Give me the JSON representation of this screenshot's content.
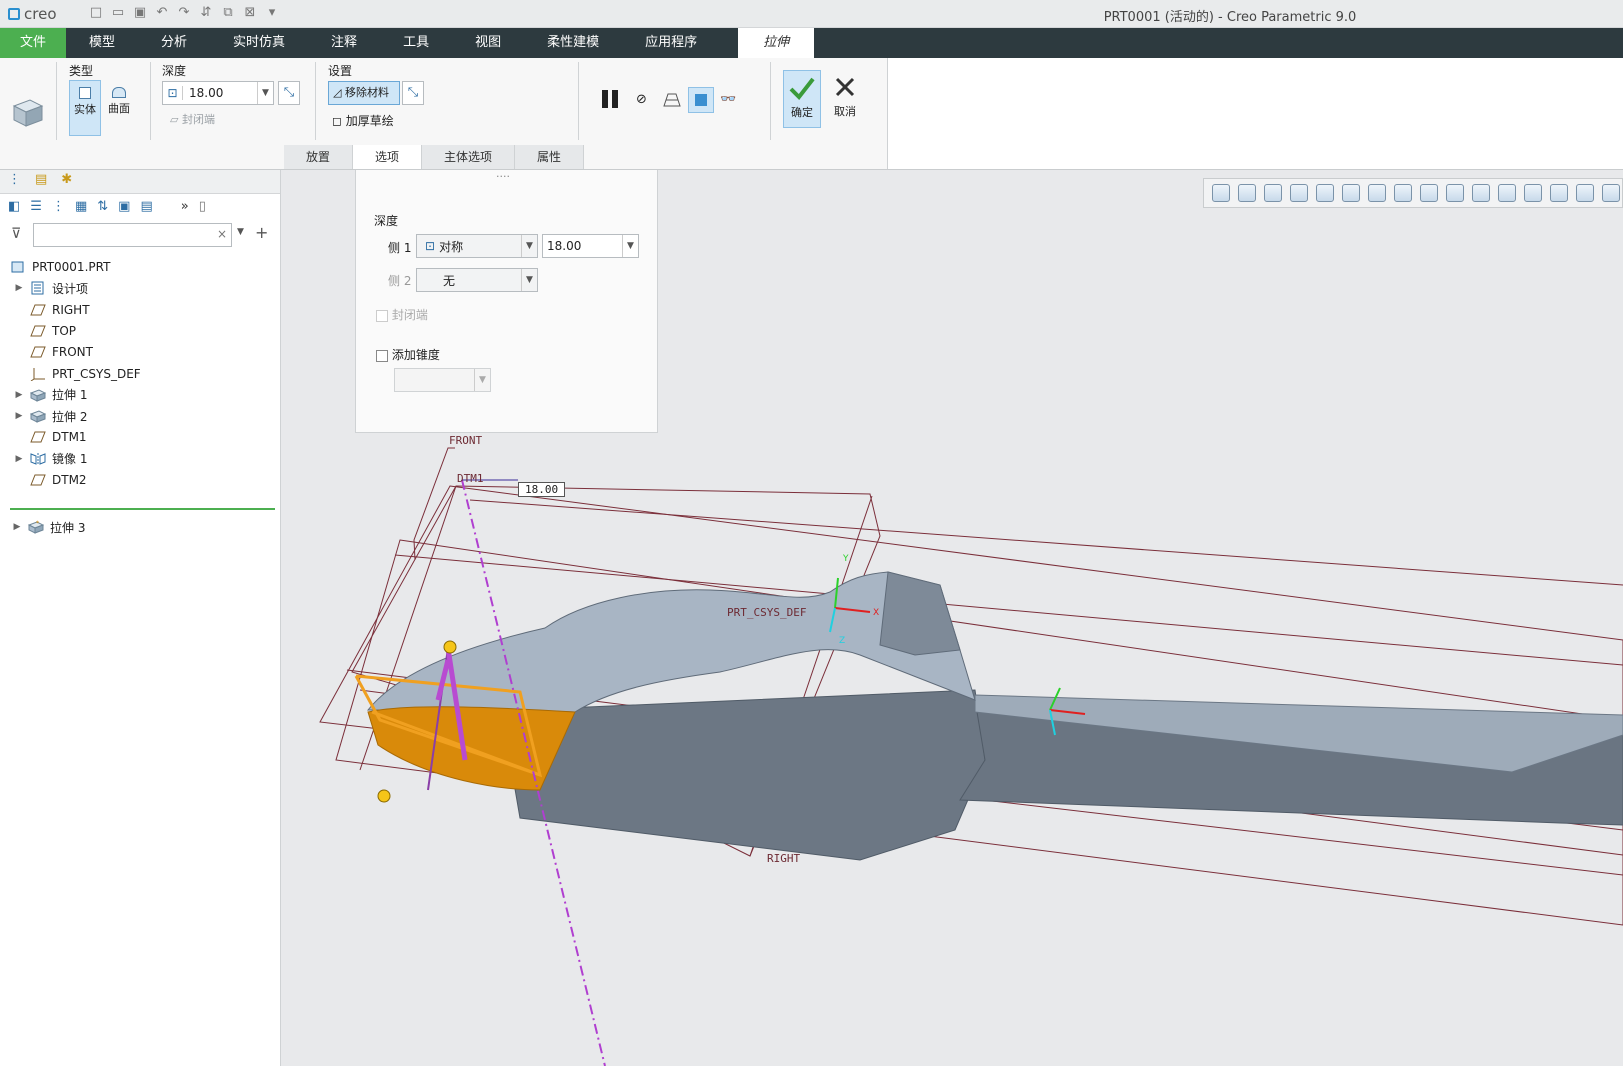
{
  "app": {
    "logo_text": "creo",
    "window_title": "PRT0001 (活动的) - Creo Parametric 9.0"
  },
  "tabs": {
    "file": "文件",
    "items": [
      "模型",
      "分析",
      "实时仿真",
      "注释",
      "工具",
      "视图",
      "柔性建模",
      "应用程序"
    ],
    "active": "拉伸"
  },
  "ribbon": {
    "type_label": "类型",
    "solid_label": "实体",
    "surface_label": "曲面",
    "depth_label": "深度",
    "depth_value": "18.00",
    "capped_label": "封闭端",
    "settings_label": "设置",
    "remove_material_label": "移除材料",
    "thicken_label": "加厚草绘",
    "ok_label": "确定",
    "cancel_label": "取消",
    "subtabs": [
      "放置",
      "选项",
      "主体选项",
      "属性"
    ],
    "active_subtab": "选项"
  },
  "options_panel": {
    "grip": "····",
    "depth_label": "深度",
    "side1_label": "侧 1",
    "side1_type": "对称",
    "side1_value": "18.00",
    "side2_label": "侧 2",
    "side2_type": "无",
    "capped_label": "封闭端",
    "taper_label": "添加锥度",
    "taper_value": ""
  },
  "model_tree": {
    "search_placeholder": "",
    "items": [
      {
        "label": "PRT0001.PRT",
        "icon": "part-icon",
        "expandable": false,
        "level": 0
      },
      {
        "label": "设计项",
        "icon": "design-items-icon",
        "expandable": true,
        "level": 1
      },
      {
        "label": "RIGHT",
        "icon": "datum-plane-icon",
        "expandable": false,
        "level": 1
      },
      {
        "label": "TOP",
        "icon": "datum-plane-icon",
        "expandable": false,
        "level": 1
      },
      {
        "label": "FRONT",
        "icon": "datum-plane-icon",
        "expandable": false,
        "level": 1
      },
      {
        "label": "PRT_CSYS_DEF",
        "icon": "csys-icon",
        "expandable": false,
        "level": 1
      },
      {
        "label": "拉伸 1",
        "icon": "extrude-icon",
        "expandable": true,
        "level": 1
      },
      {
        "label": "拉伸 2",
        "icon": "extrude-icon",
        "expandable": true,
        "level": 1
      },
      {
        "label": "DTM1",
        "icon": "datum-plane-icon",
        "expandable": false,
        "level": 1
      },
      {
        "label": "镜像 1",
        "icon": "mirror-icon",
        "expandable": true,
        "level": 1
      },
      {
        "label": "DTM2",
        "icon": "datum-plane-icon",
        "expandable": false,
        "level": 1
      }
    ],
    "insert_item": {
      "label": "拉伸 3",
      "icon": "extrude-new-icon",
      "expandable": true
    }
  },
  "viewport": {
    "label_front": "FRONT",
    "label_dtm1": "DTM1",
    "dim_value": "18.00",
    "label_csys": "PRT_CSYS_DEF",
    "label_right": "RIGHT",
    "axis_y": "Y",
    "axis_z": "Z",
    "axis_x": "X"
  },
  "colors": {
    "accent_green": "#4caf50",
    "tab_bar": "#2d3a3f",
    "model_top": "#a9b6c5",
    "model_side": "#6c7784",
    "cut_orange": "#d98a0a",
    "datum_plane": "#7b2f3a",
    "drag_handle": "#b84bd1"
  }
}
